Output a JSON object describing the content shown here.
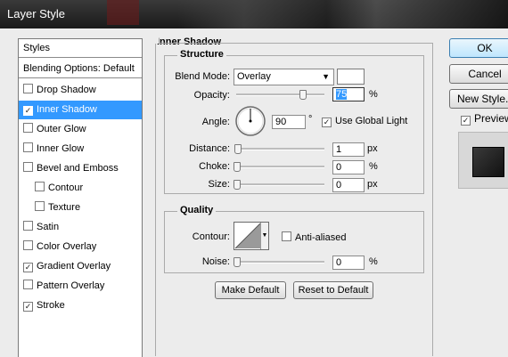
{
  "window": {
    "title": "Layer Style"
  },
  "styles_list": {
    "header": "Styles",
    "blending": "Blending Options: Default",
    "items": [
      {
        "label": "Drop Shadow",
        "checked": false,
        "selected": false
      },
      {
        "label": "Inner Shadow",
        "checked": true,
        "selected": true
      },
      {
        "label": "Outer Glow",
        "checked": false,
        "selected": false
      },
      {
        "label": "Inner Glow",
        "checked": false,
        "selected": false
      },
      {
        "label": "Bevel and Emboss",
        "checked": false,
        "selected": false
      },
      {
        "label": "Contour",
        "checked": false,
        "selected": false,
        "indent": true
      },
      {
        "label": "Texture",
        "checked": false,
        "selected": false,
        "indent": true
      },
      {
        "label": "Satin",
        "checked": false,
        "selected": false
      },
      {
        "label": "Color Overlay",
        "checked": false,
        "selected": false
      },
      {
        "label": "Gradient Overlay",
        "checked": true,
        "selected": false
      },
      {
        "label": "Pattern Overlay",
        "checked": false,
        "selected": false
      },
      {
        "label": "Stroke",
        "checked": true,
        "selected": false
      }
    ]
  },
  "panel": {
    "title": "Inner Shadow",
    "structure": {
      "legend": "Structure",
      "blend_mode_label": "Blend Mode:",
      "blend_mode_value": "Overlay",
      "blend_color": "#ffffff",
      "opacity_label": "Opacity:",
      "opacity_value": "75",
      "opacity_unit": "%",
      "opacity_level": 0.75,
      "angle_label": "Angle:",
      "angle_value": "90",
      "angle_unit": "°",
      "use_global_light_label": "Use Global Light",
      "use_global_light_checked": true,
      "distance_label": "Distance:",
      "distance_value": "1",
      "distance_unit": "px",
      "distance_level": 0.01,
      "choke_label": "Choke:",
      "choke_value": "0",
      "choke_unit": "%",
      "choke_level": 0,
      "size_label": "Size:",
      "size_value": "0",
      "size_unit": "px",
      "size_level": 0
    },
    "quality": {
      "legend": "Quality",
      "contour_label": "Contour:",
      "anti_aliased_label": "Anti-aliased",
      "anti_aliased_checked": false,
      "noise_label": "Noise:",
      "noise_value": "0",
      "noise_unit": "%",
      "noise_level": 0
    },
    "make_default_label": "Make Default",
    "reset_default_label": "Reset to Default"
  },
  "actions": {
    "ok_label": "OK",
    "cancel_label": "Cancel",
    "new_style_label": "New Style...",
    "preview_label": "Preview",
    "preview_checked": true
  }
}
